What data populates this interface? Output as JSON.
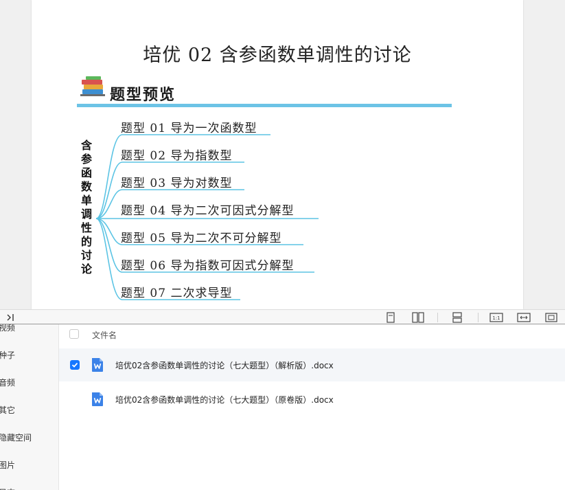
{
  "document": {
    "title": "培优 02 含参函数单调性的讨论",
    "section_title": "题型预览",
    "mindmap_root_chars": [
      "含",
      "参",
      "函",
      "数",
      "单",
      "调",
      "性",
      "的",
      "讨",
      "论"
    ],
    "branches": [
      "题型 01 导为一次函数型",
      "题型 02 导为指数型",
      "题型 03 导为对数型",
      "题型 04 导为二次可因式分解型",
      "题型 05 导为二次不可分解型",
      "题型 06 导为指数可因式分解型",
      "题型 07 二次求导型"
    ],
    "accent_color": "#6cc3e6"
  },
  "toolbar": {
    "icons": [
      "collapse-panel-icon",
      "single-page-icon",
      "two-page-icon",
      "continuous-scroll-icon",
      "actual-size-icon",
      "fit-width-icon",
      "fit-page-icon"
    ],
    "actual_size_label": "1:1"
  },
  "sidebar": {
    "items": [
      "视频",
      "种子",
      "音频",
      "其它",
      "隐藏空间",
      "图片",
      "日志"
    ]
  },
  "file_list": {
    "column_name": "文件名",
    "files": [
      {
        "name": "培优02含参函数单调性的讨论（七大题型）（解析版）.docx",
        "checked": true,
        "icon": "word-doc-icon"
      },
      {
        "name": "培优02含参函数单调性的讨论（七大题型）（原卷版）.docx",
        "checked": false,
        "icon": "word-doc-icon"
      }
    ],
    "icon_color": "#3b82e8",
    "check_color": "#1677ff"
  }
}
